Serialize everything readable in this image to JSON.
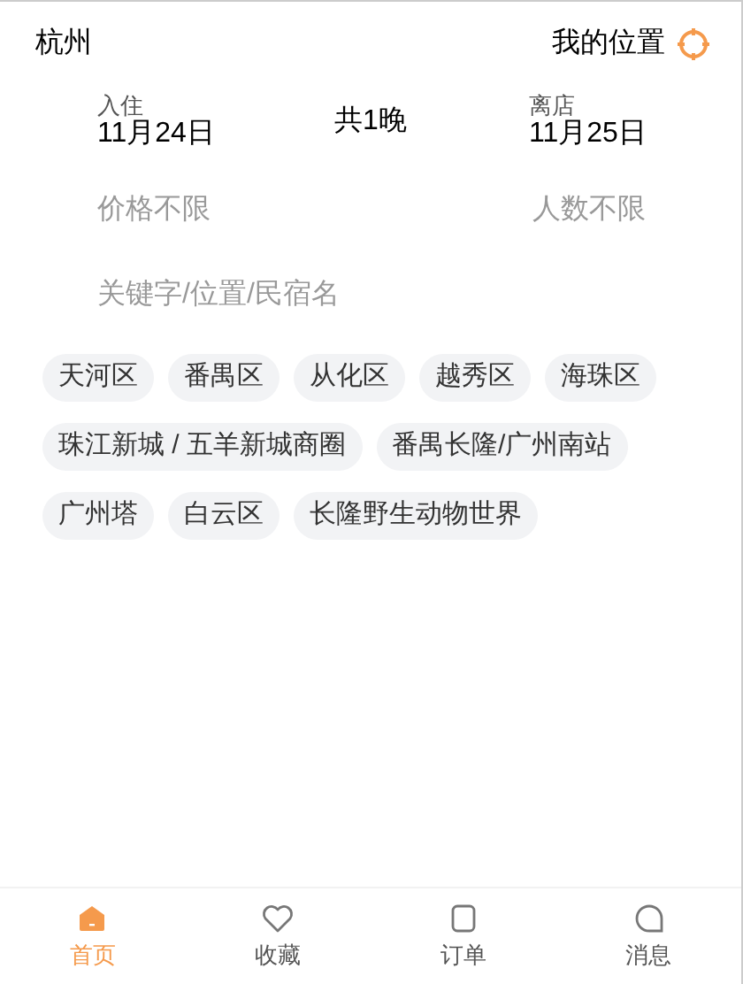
{
  "header": {
    "city": "杭州",
    "location_label": "我的位置"
  },
  "dates": {
    "checkin_label": "入住",
    "checkin_date": "11月24日",
    "nights": "共1晚",
    "checkout_label": "离店",
    "checkout_date": "11月25日"
  },
  "filters": {
    "price": "价格不限",
    "guests": "人数不限"
  },
  "search": {
    "placeholder": "关键字/位置/民宿名"
  },
  "tags": [
    "天河区",
    "番禺区",
    "从化区",
    "越秀区",
    "海珠区",
    "珠江新城 / 五羊新城商圈",
    "番禺长隆/广州南站",
    "广州塔",
    "白云区",
    "长隆野生动物世界"
  ],
  "tab_bar": [
    {
      "label": "首页",
      "kind": "home",
      "selected": true
    },
    {
      "label": "收藏",
      "kind": "heart",
      "selected": false
    },
    {
      "label": "订单",
      "kind": "order",
      "selected": false
    },
    {
      "label": "消息",
      "kind": "message",
      "selected": false
    }
  ]
}
